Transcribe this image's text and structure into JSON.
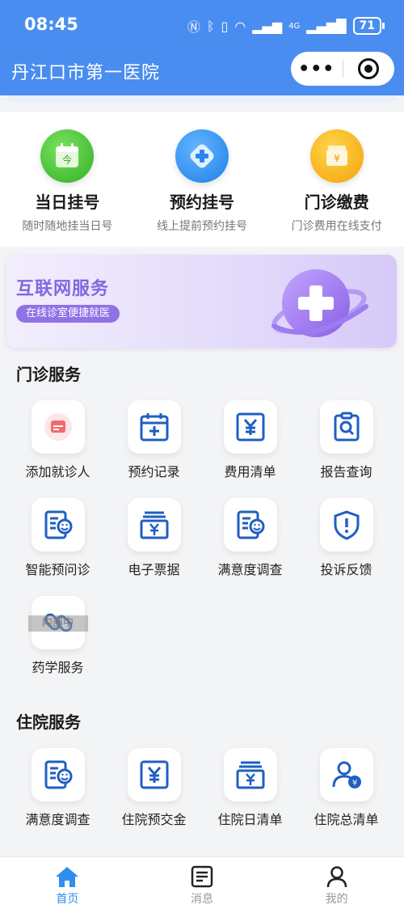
{
  "status_bar": {
    "time": "08:45",
    "battery": "71",
    "signal": "4G"
  },
  "nav": {
    "title": "丹江口市第一医院",
    "more_glyph": "•••"
  },
  "quick_actions": [
    {
      "title": "当日挂号",
      "subtitle": "随时随地挂当日号",
      "icon_text": "今",
      "icon": "calendar-today-icon",
      "color": "#3dbb3a"
    },
    {
      "title": "预约挂号",
      "subtitle": "线上提前预约挂号",
      "icon_text": "",
      "icon": "medical-cross-icon",
      "color": "#2f8df2"
    },
    {
      "title": "门诊缴费",
      "subtitle": "门诊费用在线支付",
      "icon_text": "¥",
      "icon": "payment-icon",
      "color": "#f7b416"
    }
  ],
  "banner": {
    "title": "互联网服务",
    "tag": "在线诊室便捷就医"
  },
  "outpatient": {
    "title": "门诊服务",
    "items": [
      {
        "label": "添加就诊人",
        "icon": "add-patient-card-icon"
      },
      {
        "label": "预约记录",
        "icon": "calendar-add-icon"
      },
      {
        "label": "费用清单",
        "icon": "yuan-bill-icon"
      },
      {
        "label": "报告查询",
        "icon": "report-search-icon"
      },
      {
        "label": "智能预问诊",
        "icon": "smart-consult-icon"
      },
      {
        "label": "电子票据",
        "icon": "e-receipt-icon"
      },
      {
        "label": "满意度调查",
        "icon": "survey-icon"
      },
      {
        "label": "投诉反馈",
        "icon": "complaint-shield-icon"
      },
      {
        "label": "药学服务",
        "icon": "pill-icon",
        "overlay": "内部中"
      }
    ]
  },
  "inpatient": {
    "title": "住院服务",
    "items": [
      {
        "label": "满意度调查",
        "icon": "survey-icon"
      },
      {
        "label": "住院预交金",
        "icon": "yuan-bill-icon"
      },
      {
        "label": "住院日清单",
        "icon": "daily-list-icon"
      },
      {
        "label": "住院总清单",
        "icon": "total-list-icon"
      }
    ]
  },
  "tabbar": [
    {
      "label": "首页",
      "icon": "home-icon",
      "active": true
    },
    {
      "label": "消息",
      "icon": "message-icon",
      "active": false
    },
    {
      "label": "我的",
      "icon": "profile-icon",
      "active": false
    }
  ],
  "colors": {
    "brand": "#4a8df0",
    "icon_blue": "#1f5fc2",
    "accent_purple": "#8466e0",
    "tab_active": "#2e8ff0"
  }
}
